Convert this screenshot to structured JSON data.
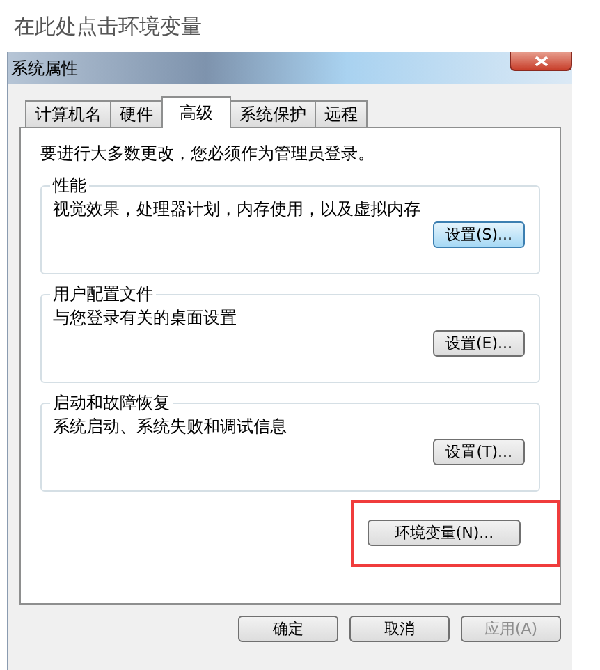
{
  "instruction": "在此处点击环境变量",
  "window": {
    "title": "系统属性"
  },
  "tabs": [
    {
      "label": "计算机名",
      "selected": false
    },
    {
      "label": "硬件",
      "selected": false
    },
    {
      "label": "高级",
      "selected": true
    },
    {
      "label": "系统保护",
      "selected": false
    },
    {
      "label": "远程",
      "selected": false
    }
  ],
  "notice": "要进行大多数更改，您必须作为管理员登录。",
  "groups": [
    {
      "title": "性能",
      "description": "视觉效果，处理器计划，内存使用，以及虚拟内存",
      "button": {
        "label": "设置(S)...",
        "focused": true
      }
    },
    {
      "title": "用户配置文件",
      "description": "与您登录有关的桌面设置",
      "button": {
        "label": "设置(E)...",
        "focused": false
      }
    },
    {
      "title": "启动和故障恢复",
      "description": "系统启动、系统失败和调试信息",
      "button": {
        "label": "设置(T)...",
        "focused": false
      }
    }
  ],
  "env_button": {
    "label": "环境变量(N)...",
    "highlighted": true
  },
  "footer_buttons": [
    {
      "label": "确定",
      "disabled": false
    },
    {
      "label": "取消",
      "disabled": false
    },
    {
      "label": "应用(A)",
      "disabled": true
    }
  ]
}
